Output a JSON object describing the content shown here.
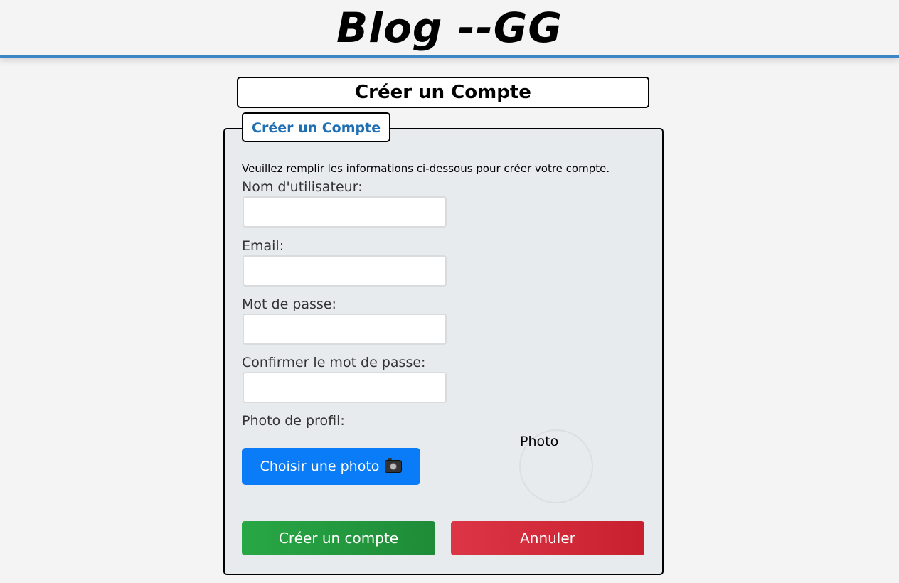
{
  "site": {
    "title": "Blog --GG"
  },
  "page": {
    "title": "Créer un Compte"
  },
  "form": {
    "legend": "Créer un Compte",
    "intro": "Veuillez remplir les informations ci-dessous pour créer votre compte.",
    "fields": {
      "username": {
        "label": "Nom d'utilisateur:",
        "value": ""
      },
      "email": {
        "label": "Email:",
        "value": ""
      },
      "password": {
        "label": "Mot de passe:",
        "value": ""
      },
      "confirm_password": {
        "label": "Confirmer le mot de passe:",
        "value": ""
      }
    },
    "photo": {
      "label": "Photo de profil:",
      "button_label": "Choisir une photo",
      "button_icon": "camera-icon",
      "preview_alt": "Photo"
    },
    "actions": {
      "submit_label": "Créer un compte",
      "cancel_label": "Annuler"
    }
  },
  "colors": {
    "header_border": "#3d86c6",
    "legend_text": "#1f6fb2",
    "photo_button": "#0a7cf7",
    "submit_button": "#28a745",
    "cancel_button": "#dc3545",
    "form_background": "#e8ebee"
  }
}
